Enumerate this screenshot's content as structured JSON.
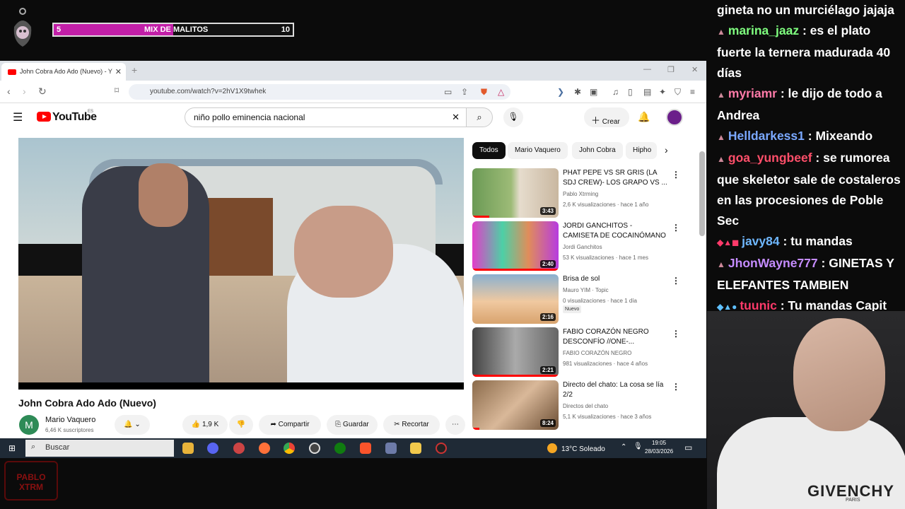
{
  "overlay": {
    "progress_left": "5",
    "progress_title": "MIX DE MALITOS",
    "progress_right": "10",
    "progress_fraction": 0.5
  },
  "chat": [
    {
      "user": "",
      "text": "gineta no un murciélago jajaja",
      "color": "#ffffff"
    },
    {
      "user": "marina_jaaz",
      "text": ": es el plato fuerte la ternera madurada 40 días",
      "color": "#7fff7f"
    },
    {
      "user": "myriamr",
      "text": ": le dijo de todo a Andrea",
      "color": "#ff7aa8"
    },
    {
      "user": "Helldarkess1",
      "text": ": Mixeando",
      "color": "#7aa8ff"
    },
    {
      "user": "goa_yungbeef",
      "text": ": se rumorea que skeletor sale de costaleros en las procesiones de Poble Sec",
      "color": "#ff4f6a"
    },
    {
      "user": "javy84",
      "text": ": tu mandas",
      "color": "#6fb8ff"
    },
    {
      "user": "JhonWayne777",
      "text": ": GINETAS Y ELEFANTES TAMBIEN",
      "color": "#c58cff"
    },
    {
      "user": "tuunic",
      "text": ": Tu mandas Capit",
      "color": "#ff3a6a"
    }
  ],
  "streamer": {
    "brand": "GIVENCHY",
    "brand_sub": "PARIS",
    "watermark": "PABLO XTRM"
  },
  "browser": {
    "tab_title": "John Cobra Ado Ado (Nuevo) - Y",
    "url": "youtube.com/watch?v=2hV1X9twhek"
  },
  "youtube": {
    "logo": "YouTube",
    "region": "ES",
    "search_value": "niño pollo eminencia nacional",
    "create_label": "Crear",
    "video_title": "John Cobra Ado Ado (Nuevo)",
    "channel_initial": "M",
    "channel_name": "Mario Vaquero",
    "channel_subs": "6,46 K suscriptores",
    "likes": "1,9 K",
    "share_label": "Compartir",
    "save_label": "Guardar",
    "clip_label": "Recortar",
    "chips": [
      "Todos",
      "Mario Vaquero",
      "John Cobra",
      "Hipho"
    ],
    "recommendations": [
      {
        "title": "PHAT PEPE VS SR GRIS (LA SDJ CREW)- LOS GRAPO VS ...",
        "channel": "Pablo Xtrming",
        "views": "2,6 K visualizaciones · hace 1 año",
        "duration": "3:43",
        "watched": 0.2
      },
      {
        "title": "JORDI GANCHITOS - CAMISETA DE COCAINÓMANO",
        "channel": "Jordi Ganchitos",
        "views": "53 K visualizaciones · hace 1 mes",
        "duration": "2:40",
        "watched": 1.0
      },
      {
        "title": "Brisa de sol",
        "channel": "Mauro YIM · Topic",
        "views": "0 visualizaciones · hace 1 día",
        "duration": "2:16",
        "badge": "Nuevo",
        "watched": 0
      },
      {
        "title": "FABIO CORAZÓN NEGRO DESCONFÍO //ONE-...",
        "channel": "FABIO CORAZÓN NEGRO",
        "views": "981 visualizaciones · hace 4 años",
        "duration": "2:21",
        "watched": 1.0
      },
      {
        "title": "Directo del chato: La cosa se lía 2/2",
        "channel": "Directos del chato",
        "views": "5,1 K visualizaciones · hace 3 años",
        "duration": "8:24",
        "watched": 0.08
      }
    ]
  },
  "taskbar": {
    "search_placeholder": "Buscar",
    "temp": "13°C",
    "weather": "Soleado",
    "time": "19:05",
    "date": "28/03/2026"
  }
}
